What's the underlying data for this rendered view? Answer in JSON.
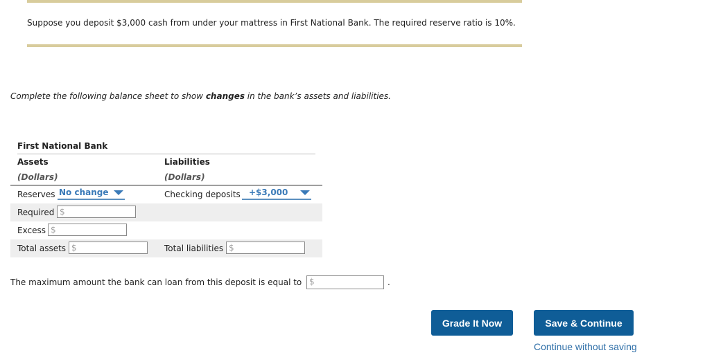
{
  "scenario": "Suppose you deposit $3,000 cash from under your mattress in First National Bank. The required reserve ratio is 10%.",
  "instruction": {
    "before": "Complete the following balance sheet to show ",
    "emphasis": "changes",
    "after": " in the bank’s assets and liabilities."
  },
  "balance_sheet": {
    "bank_name": "First National Bank",
    "assets_header": "Assets",
    "liabilities_header": "Liabilities",
    "unit_label": "(Dollars)",
    "rows": {
      "reserves": {
        "label": "Reserves",
        "selected": "No change"
      },
      "checking_deposits": {
        "label": "Checking deposits",
        "selected": "+$3,000"
      },
      "required": {
        "label": "Required",
        "value": ""
      },
      "excess": {
        "label": "Excess",
        "value": ""
      },
      "total_assets": {
        "label": "Total assets",
        "value": ""
      },
      "total_liabilities": {
        "label": "Total liabilities",
        "value": ""
      }
    },
    "currency_symbol": "$"
  },
  "loan_question": {
    "text": "The maximum amount the bank can loan from this deposit is equal to",
    "value": "",
    "period": "."
  },
  "buttons": {
    "grade": "Grade It Now",
    "save": "Save & Continue",
    "continue_without_saving": "Continue without saving"
  },
  "colors": {
    "accent_button": "#0f5d97",
    "dropdown_text": "#3a7ab8",
    "rule": "#d8cc9c"
  }
}
